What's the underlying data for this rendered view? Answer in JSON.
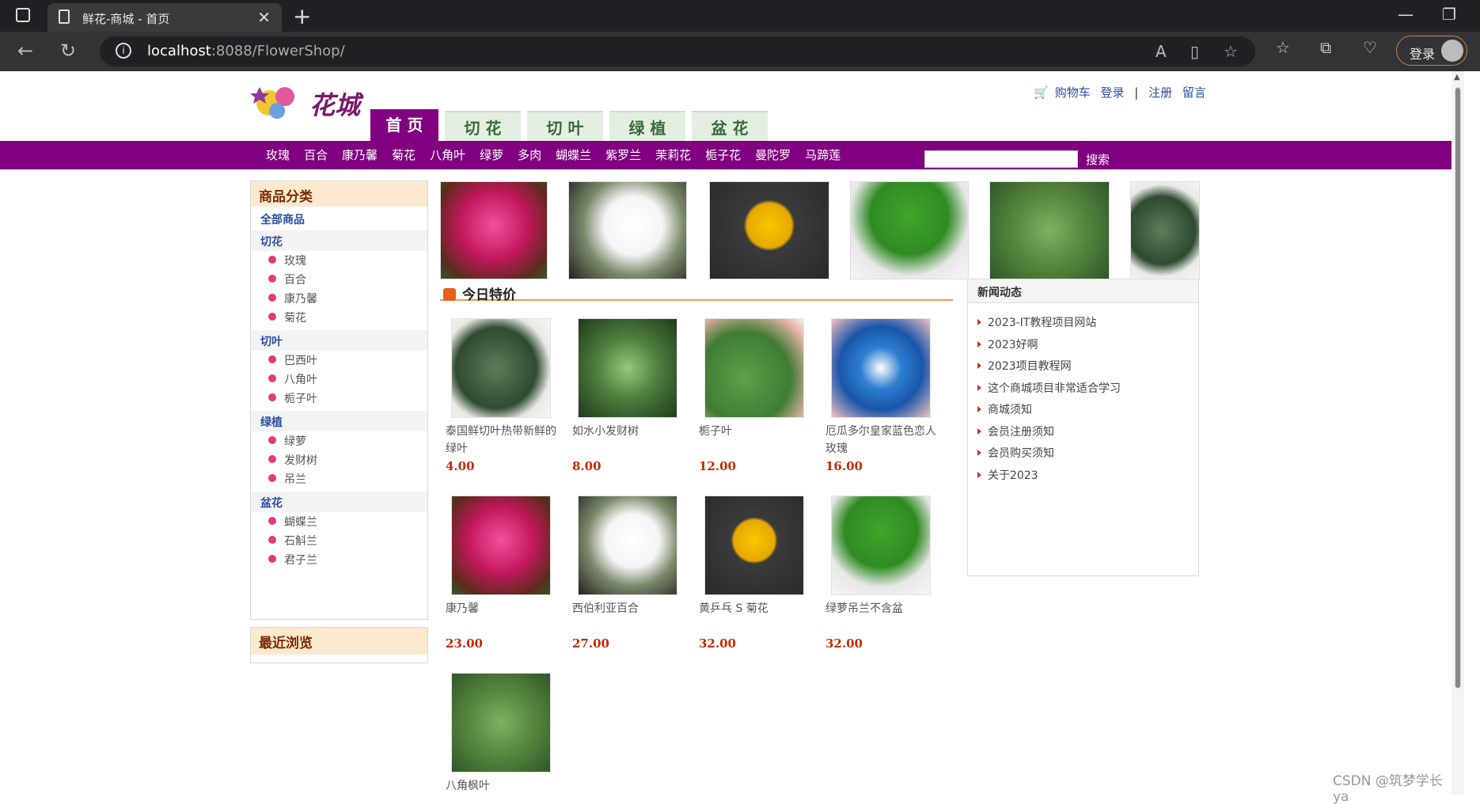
{
  "browser": {
    "tab_title": "鲜花-商城 - 首页",
    "url_host": "localhost",
    "url_path": ":8088/FlowerShop/",
    "login_label": "登录"
  },
  "header": {
    "logo_text": "花城",
    "cart_label": "购物车",
    "links": [
      "登录",
      "|",
      "注册",
      "留言"
    ]
  },
  "nav_tabs": [
    "首 页",
    "切 花",
    "切 叶",
    "绿 植",
    "盆 花"
  ],
  "category_bar": {
    "items": [
      "玫瑰",
      "百合",
      "康乃馨",
      "菊花",
      "八角叶",
      "绿萝",
      "多肉",
      "蝴蝶兰",
      "紫罗兰",
      "茉莉花",
      "栀子花",
      "曼陀罗",
      "马蹄莲"
    ],
    "search_placeholder": "",
    "search_label": "搜索"
  },
  "sidebar": {
    "title": "商品分类",
    "all_label": "全部商品",
    "groups": [
      {
        "label": "切花",
        "items": [
          "玫瑰",
          "百合",
          "康乃馨",
          "菊花"
        ]
      },
      {
        "label": "切叶",
        "items": [
          "巴西叶",
          "八角叶",
          "栀子叶"
        ]
      },
      {
        "label": "绿植",
        "items": [
          "绿萝",
          "发财树",
          "吊兰"
        ]
      },
      {
        "label": "盆花",
        "items": [
          "蝴蝶兰",
          "石斛兰",
          "君子兰"
        ]
      }
    ],
    "recent_title": "最近浏览"
  },
  "specials": {
    "title": "今日特价",
    "products": [
      {
        "name": "泰国鲜切叶热带新鲜的绿叶",
        "price": "4.00",
        "img": "heart-leaf"
      },
      {
        "name": "如水小发财树",
        "price": "8.00",
        "img": "money-tree"
      },
      {
        "name": "栀子叶",
        "price": "12.00",
        "img": "gardenia-leaf"
      },
      {
        "name": "厄瓜多尔皇家蓝色恋人玫瑰",
        "price": "16.00",
        "img": "blue-rose"
      },
      {
        "name": "康乃馨",
        "price": "23.00",
        "img": "carnation"
      },
      {
        "name": "西伯利亚百合",
        "price": "27.00",
        "img": "lily"
      },
      {
        "name": "黄乒乓 S 菊花",
        "price": "32.00",
        "img": "chrysanthemum"
      },
      {
        "name": "绿萝吊兰不含盆",
        "price": "32.00",
        "img": "pothos"
      },
      {
        "name": "八角枫叶",
        "price": "",
        "img": "fatsia-leaf"
      }
    ]
  },
  "news": {
    "title": "新闻动态",
    "items": [
      "2023-IT教程项目网站",
      "2023好啊",
      "2023项目教程网",
      "这个商城项目非常适合学习",
      "商城须知",
      "会员注册须知",
      "会员购买须知",
      "关于2023"
    ]
  },
  "watermark": "CSDN @筑梦学长ya",
  "colors": {
    "brand_purple": "#800080",
    "price_red": "#c62800",
    "link_blue": "#2a4fa0"
  }
}
